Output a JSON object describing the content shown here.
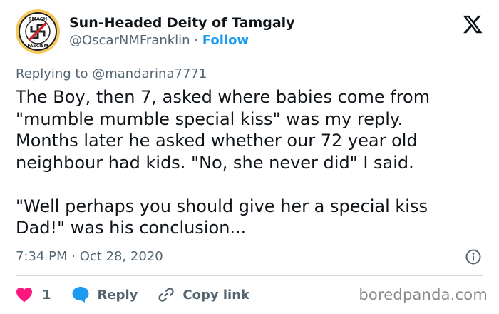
{
  "author": {
    "display_name": "Sun-Headed Deity of Tamgaly",
    "handle": "@OscarNMFranklin",
    "separator": "·",
    "follow_label": "Follow",
    "avatar_icon": "anti-fascist-logo-icon",
    "avatar_text_top": "SMASH",
    "avatar_text_bottom": "FASCISM"
  },
  "replying": {
    "prefix": "Replying to",
    "mention": "@mandarina7771"
  },
  "tweet": {
    "lines": [
      "The Boy, then 7, asked where babies come from",
      "\"mumble mumble special kiss\" was my reply.",
      "Months later he asked whether our 72 year old",
      "neighbour had kids. \"No, she never did\" I said.",
      "",
      "\"Well perhaps you should give her a special kiss",
      "Dad!\" was his conclusion..."
    ],
    "time": "7:34 PM",
    "separator": "·",
    "date": "Oct 28, 2020"
  },
  "actions": {
    "like_count": "1",
    "reply_label": "Reply",
    "copy_link_label": "Copy link"
  },
  "watermark": "boredpanda.com",
  "colors": {
    "accent": "#1d9bf0",
    "like": "#f91880",
    "muted": "#536471",
    "text": "#0f1419"
  }
}
